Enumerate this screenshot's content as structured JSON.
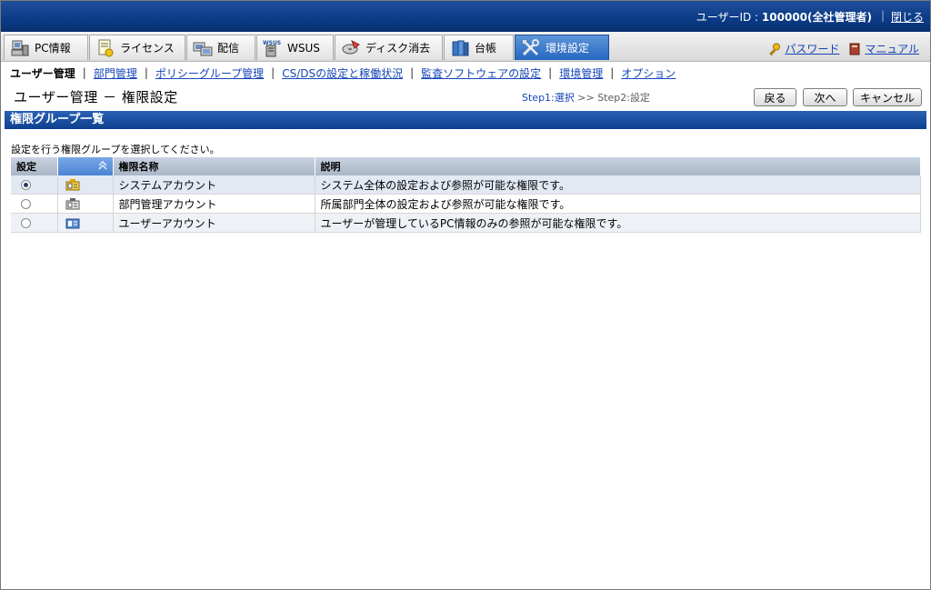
{
  "header": {
    "user_label": "ユーザーID : ",
    "user_value": "100000(全社管理者)",
    "separator": "|",
    "close_label": "閉じる"
  },
  "tabs": [
    {
      "label": "PC情報",
      "icon": "pc-icon",
      "active": false
    },
    {
      "label": "ライセンス",
      "icon": "license-icon",
      "active": false
    },
    {
      "label": "配信",
      "icon": "distribution-icon",
      "active": false
    },
    {
      "label": "WSUS",
      "icon": "wsus-icon",
      "active": false
    },
    {
      "label": "ディスク消去",
      "icon": "disk-erase-icon",
      "active": false
    },
    {
      "label": "台帳",
      "icon": "ledger-icon",
      "active": false
    },
    {
      "label": "環境設定",
      "icon": "settings-tools-icon",
      "active": true
    }
  ],
  "right_links": {
    "password": "パスワード",
    "manual": "マニュアル"
  },
  "subnav": {
    "current": "ユーザー管理",
    "links": [
      "部門管理",
      "ポリシーグループ管理",
      "CS/DSの設定と稼働状況",
      "監査ソフトウェアの設定",
      "環境管理",
      "オプション"
    ],
    "pipe": "|"
  },
  "page": {
    "title": "ユーザー管理 － 権限設定",
    "step1": "Step1:選択",
    "step_sep": " >> ",
    "step2": "Step2:設定",
    "buttons": {
      "back": "戻る",
      "next": "次へ",
      "cancel": "キャンセル"
    }
  },
  "section": {
    "title": "権限グループ一覧",
    "instruction": "設定を行う権限グループを選択してください。"
  },
  "table": {
    "headers": {
      "select": "設定",
      "name": "権限名称",
      "description": "説明"
    },
    "rows": [
      {
        "selected": true,
        "icon": "system-account-icon",
        "name": "システムアカウント",
        "description": "システム全体の設定および参照が可能な権限です。"
      },
      {
        "selected": false,
        "icon": "department-account-icon",
        "name": "部門管理アカウント",
        "description": "所属部門全体の設定および参照が可能な権限です。"
      },
      {
        "selected": false,
        "icon": "user-account-icon",
        "name": "ユーザーアカウント",
        "description": "ユーザーが管理しているPC情報のみの参照が可能な権限です。"
      }
    ]
  },
  "colors": {
    "header_blue": "#0b3a86",
    "active_tab": "#2466c0",
    "link": "#1545b8"
  }
}
